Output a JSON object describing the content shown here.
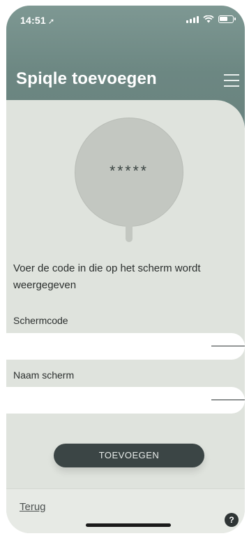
{
  "status_bar": {
    "time": "14:51",
    "location_glyph": "➚"
  },
  "header": {
    "title": "Spiqle toevoegen",
    "menu_icon": "hamburger-menu-icon"
  },
  "illustration": {
    "code_display": "*****"
  },
  "instruction": "Voer de code in die op het scherm wordt weergegeven",
  "form": {
    "screen_code": {
      "label": "Schermcode",
      "value": "",
      "placeholder": ""
    },
    "screen_name": {
      "label": "Naam scherm",
      "value": "",
      "placeholder": ""
    },
    "submit_label": "TOEVOEGEN"
  },
  "footer": {
    "back_label": "Terug",
    "help_label": "?"
  },
  "colors": {
    "header_bg": "#6c8782",
    "card_bg": "#dfe3dd",
    "button_bg": "#3b4545",
    "button_text": "#e8ecea"
  }
}
